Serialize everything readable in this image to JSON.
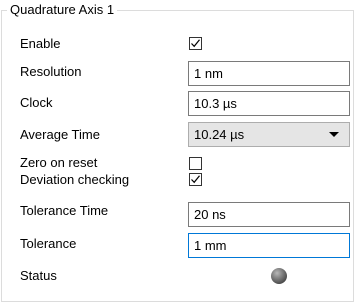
{
  "group": {
    "title": "Quadrature Axis 1"
  },
  "fields": {
    "enable": {
      "label": "Enable",
      "checked": true
    },
    "resolution": {
      "label": "Resolution",
      "value": "1 nm"
    },
    "clock": {
      "label": "Clock",
      "value": "10.3 µs"
    },
    "average_time": {
      "label": "Average Time",
      "value": "10.24 µs"
    },
    "zero_on_reset": {
      "label": "Zero on reset",
      "checked": false
    },
    "deviation_checking": {
      "label": "Deviation checking",
      "checked": true
    },
    "tolerance_time": {
      "label": "Tolerance Time",
      "value": "20 ns"
    },
    "tolerance": {
      "label": "Tolerance",
      "value": "1 mm"
    },
    "status": {
      "label": "Status",
      "indicator_color": "#5a5a5a"
    }
  },
  "icons": {
    "checkmark": "check-icon",
    "dropdown": "chevron-down-icon",
    "status": "status-led-icon"
  },
  "colors": {
    "focus_border": "#0078d7",
    "combo_background": "#e5e5e5",
    "group_border": "#dcdcdc"
  }
}
